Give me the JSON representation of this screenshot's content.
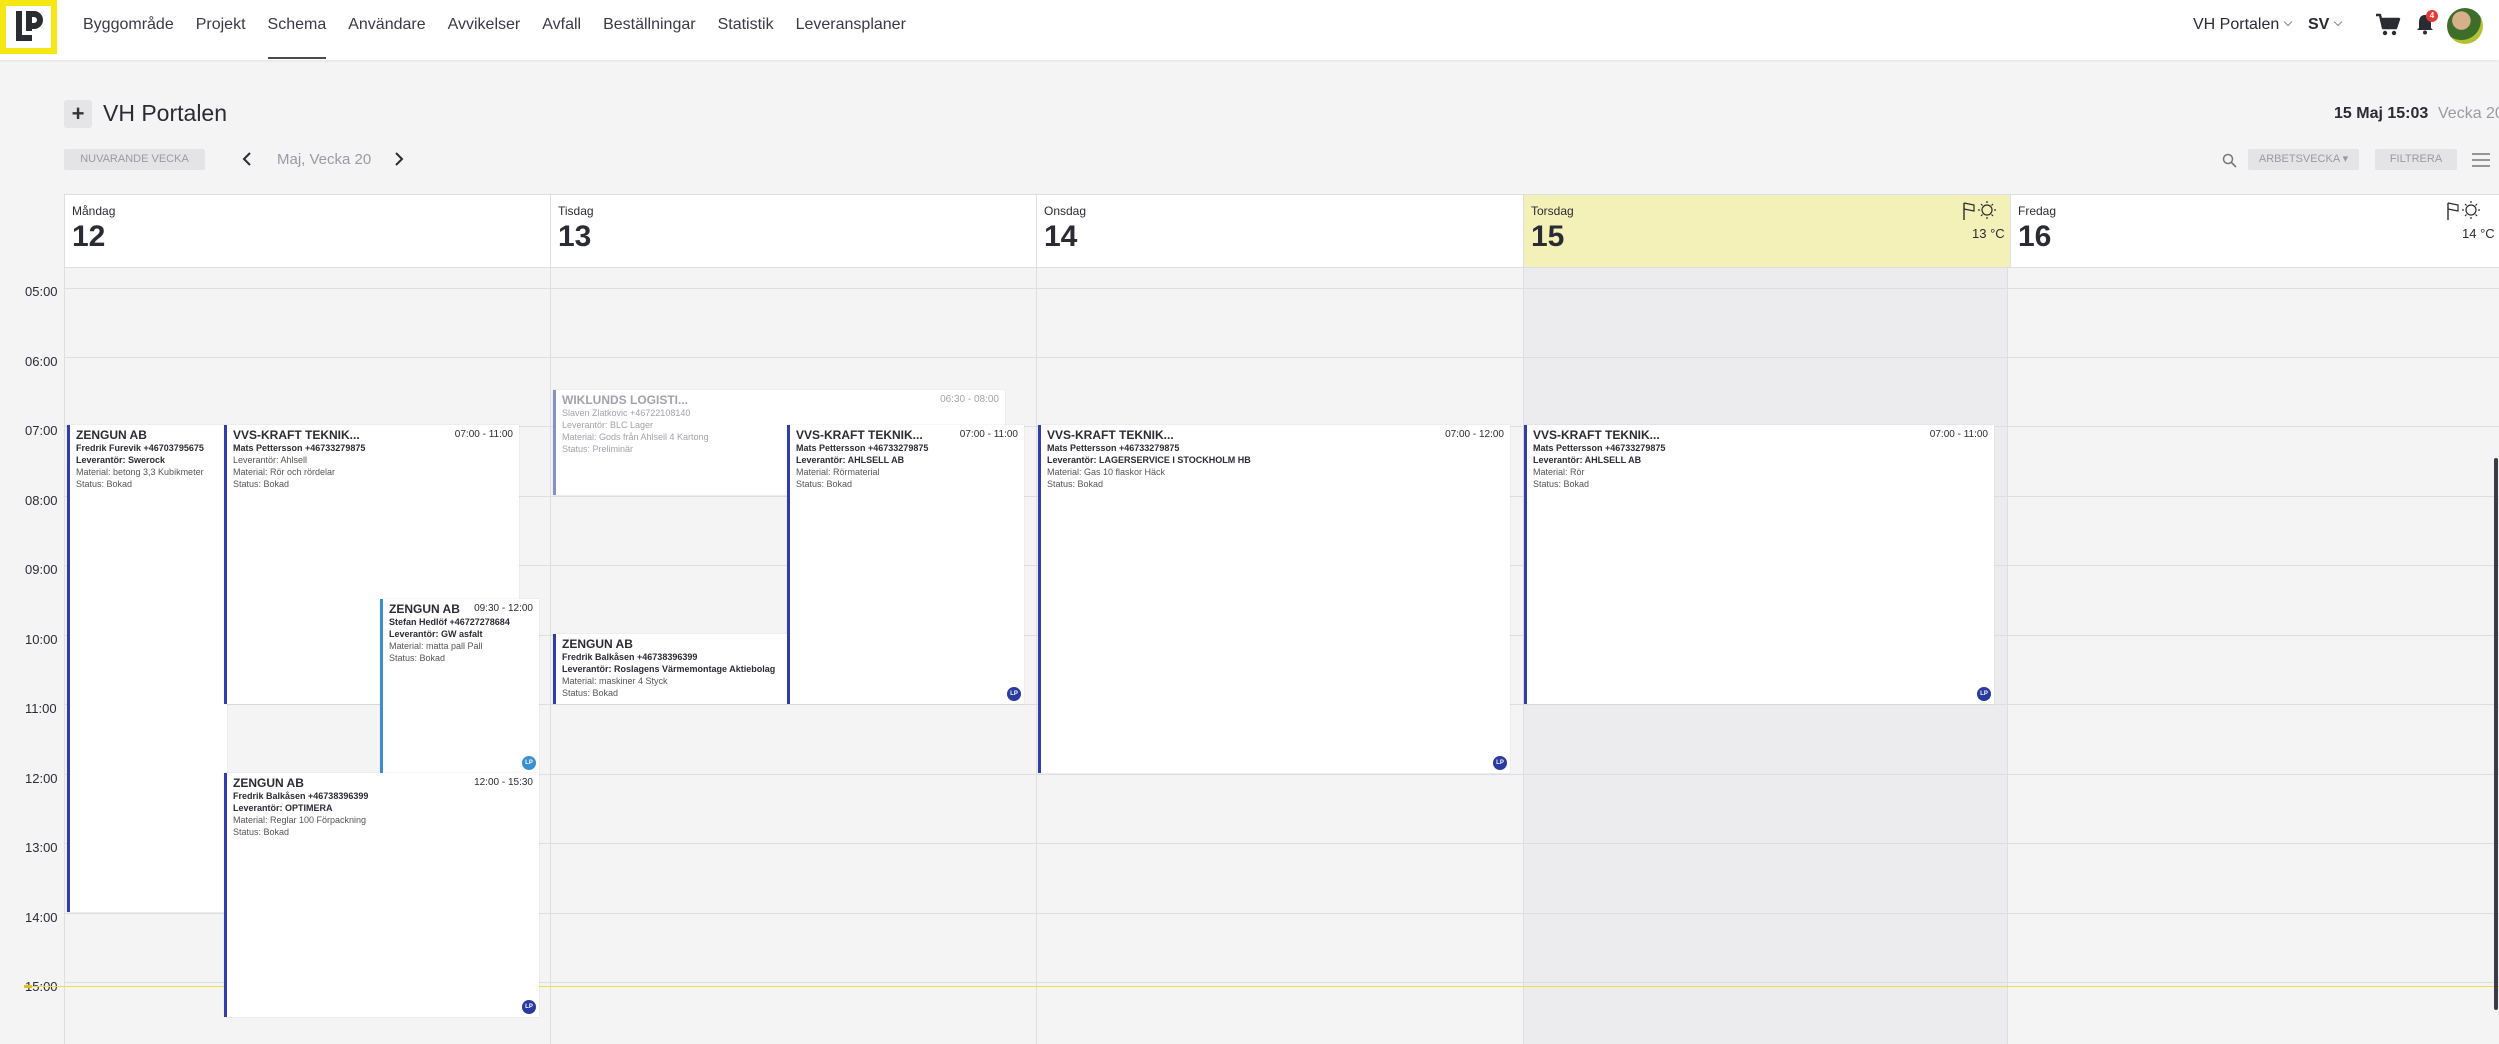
{
  "nav": {
    "items": [
      "Byggområde",
      "Projekt",
      "Schema",
      "Användare",
      "Avvikelser",
      "Avfall",
      "Beställningar",
      "Statistik",
      "Leveransplaner"
    ],
    "active": "Schema",
    "portal": "VH Portalen",
    "lang": "SV",
    "notif_count": "4"
  },
  "header": {
    "add": "+",
    "title": "VH Portalen",
    "now_time": "15 Maj 15:03",
    "now_week": "Vecka 20"
  },
  "toolbar": {
    "current_week": "NUVARANDE VECKA",
    "prev": "‹",
    "week_label": "Maj, Vecka 20",
    "next": "›",
    "workweek": "ARBETSVECKA ▾",
    "filter": "FILTRERA"
  },
  "days": [
    {
      "name": "Måndag",
      "num": "12",
      "today": false
    },
    {
      "name": "Tisdag",
      "num": "13",
      "today": false
    },
    {
      "name": "Onsdag",
      "num": "14",
      "today": false
    },
    {
      "name": "Torsdag",
      "num": "15",
      "today": true,
      "temp": "13 °C"
    },
    {
      "name": "Fredag",
      "num": "16",
      "today": false,
      "temp": "14 °C"
    }
  ],
  "hours": [
    "05:00",
    "06:00",
    "07:00",
    "08:00",
    "09:00",
    "10:00",
    "11:00",
    "12:00",
    "13:00",
    "14:00",
    "15:00"
  ],
  "events": [
    {
      "title": "ZENGUN AB",
      "time": "",
      "contact": "Fredrik Furevik +46703795675",
      "supplier": "Leverantör: Swerock",
      "material": "Material: betong 3,3 Kubikmeter",
      "status": "Status: Bokad",
      "badge": false
    },
    {
      "title": "VVS-KRAFT TEKNIK...",
      "time": "07:00 - 11:00",
      "contact": "Mats Pettersson +46733279875",
      "supplier": "Leverantör: Ahlsell",
      "material": "Material: Rör och rördelar",
      "status": "Status: Bokad",
      "badge": false
    },
    {
      "title": "ZENGUN AB",
      "time": "09:30 - 12:00",
      "contact": "Stefan Hedlöf +46727278684",
      "supplier": "Leverantör: GW asfalt",
      "material": "Material: matta pall Pall",
      "status": "Status: Bokad",
      "badge": true
    },
    {
      "title": "ZENGUN AB",
      "time": "12:00 - 15:30",
      "contact": "Fredrik Balkåsen +46738396399",
      "supplier": "Leverantör: OPTIMERA",
      "material": "Material: Reglar 100 Förpackning",
      "status": "Status: Bokad",
      "badge": true
    },
    {
      "title": "WIKLUNDS LOGISTI...",
      "time": "06:30 - 08:00",
      "contact": "Slaven Zlatkovic +46722108140",
      "supplier": "Leverantör: BLC Lager",
      "material": "Material: Gods från Ahlsell 4 Kartong",
      "status": "Status: Preliminär",
      "badge": false
    },
    {
      "title": "VVS-KRAFT TEKNIK...",
      "time": "07:00 - 11:00",
      "contact": "Mats Pettersson +46733279875",
      "supplier": "Leverantör: AHLSELL AB",
      "material": "Material: Rörmaterial",
      "status": "Status: Bokad",
      "badge": true
    },
    {
      "title": "ZENGUN AB",
      "time": "",
      "contact": "Fredrik Balkåsen +46738396399",
      "supplier": "Leverantör: Roslagens Värmemontage Aktiebolag",
      "material": "Material: maskiner 4 Styck",
      "status": "Status: Bokad",
      "badge": false
    },
    {
      "title": "VVS-KRAFT TEKNIK...",
      "time": "07:00 - 12:00",
      "contact": "Mats Pettersson +46733279875",
      "supplier": "Leverantör: LAGERSERVICE I STOCKHOLM HB",
      "material": "Material: Gas 10 flaskor Häck",
      "status": "Status: Bokad",
      "badge": true
    },
    {
      "title": "VVS-KRAFT TEKNIK...",
      "time": "07:00 - 11:00",
      "contact": "Mats Pettersson +46733279875",
      "supplier": "Leverantör: AHLSELL AB",
      "material": "Material: Rör",
      "status": "Status: Bokad",
      "badge": true
    }
  ],
  "badge_label": "LP",
  "colors": {
    "accent": "#2f3ea8",
    "today_bg": "#f3f0b8",
    "logo_yellow": "#f6e614",
    "now_line": "#f0dd4a"
  }
}
